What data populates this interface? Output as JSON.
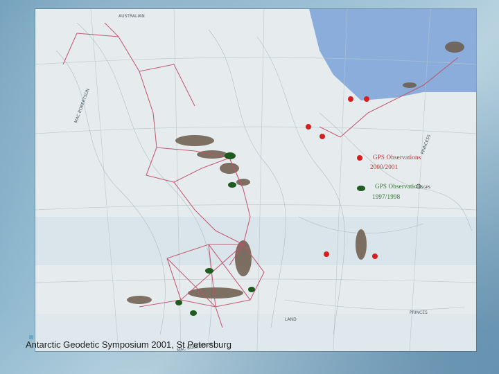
{
  "slide": {
    "footer": "Antarctic Geodetic Symposium 2001, St Petersburg"
  },
  "legend": {
    "gps_2000": {
      "label": "GPS Observations",
      "period": "2000/2001",
      "color": "#d42020"
    },
    "gps_1997": {
      "label": "GPS Observations",
      "period": "1997/1998",
      "color": "#1f5a1f"
    }
  },
  "map_labels": {
    "top": "AUSTRALIAN",
    "left": "MAC ROBERTSON",
    "lower_left": "MAC ROBERTSON",
    "right": "PRINCESS",
    "bottom_right": "PRINCES",
    "middle": "LAND",
    "gps_key": "GPS"
  },
  "colors": {
    "map_paper": "#e8eef0",
    "sea": "#7fa6d8",
    "traverse": "#c0506a",
    "station_red": "#d42020",
    "station_green": "#1f5a1f"
  }
}
